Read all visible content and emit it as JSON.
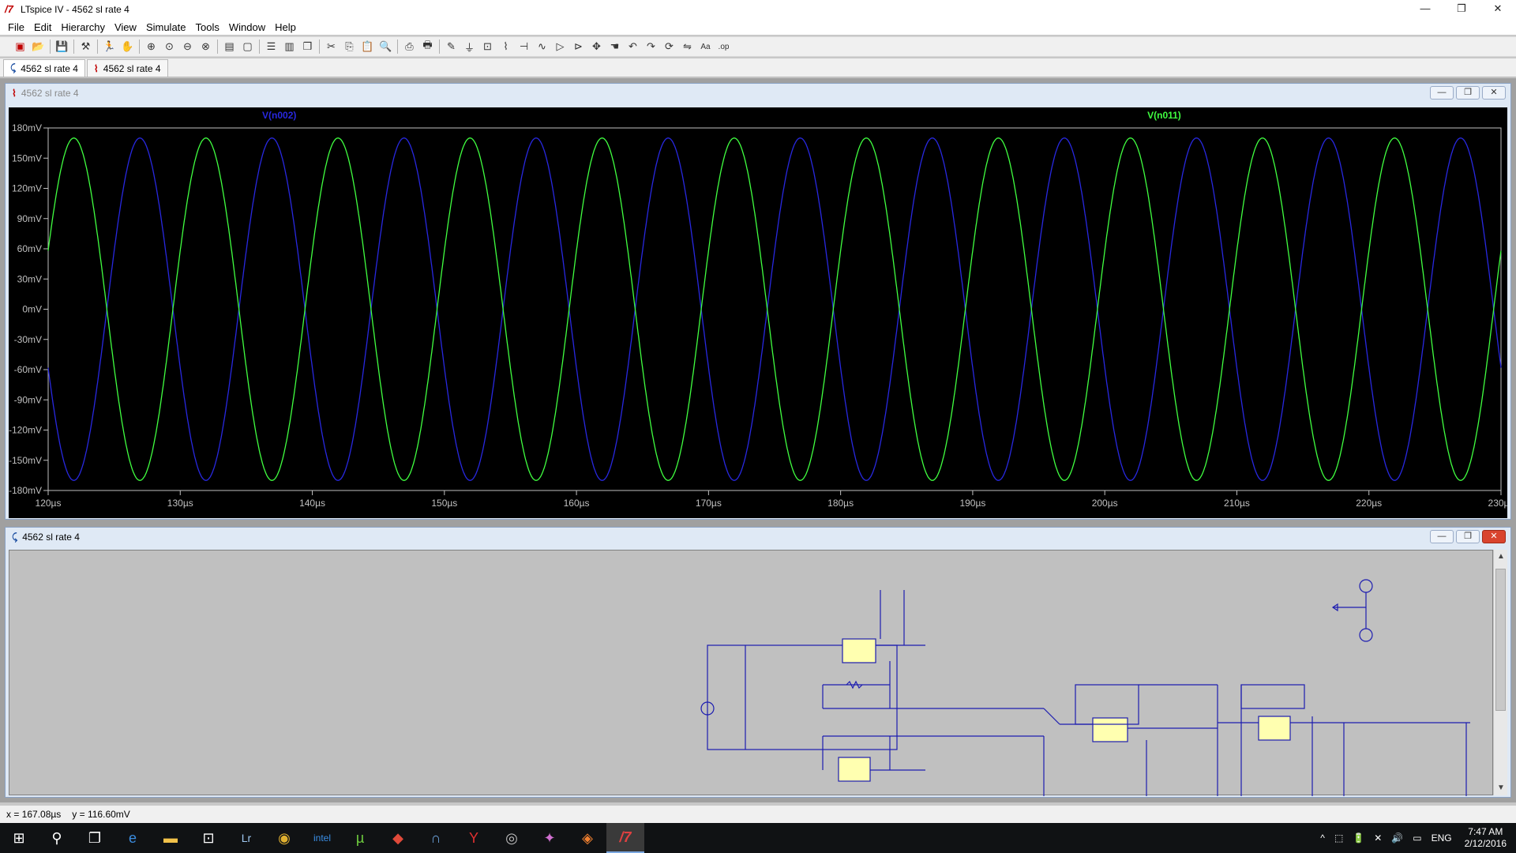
{
  "app": {
    "window_title": "LTspice IV - 4562  sl rate 4",
    "caption_buttons": [
      "—",
      "❐",
      "✕"
    ]
  },
  "menu": [
    "File",
    "Edit",
    "Hierarchy",
    "View",
    "Simulate",
    "Tools",
    "Window",
    "Help"
  ],
  "toolbar_icons": [
    "new-schematic-icon",
    "open-icon",
    "sep",
    "save-icon",
    "sep",
    "control-panel-icon",
    "sep",
    "run-icon",
    "halt-icon",
    "sep",
    "zoom-in-icon",
    "zoom-area-icon",
    "zoom-out-icon",
    "zoom-cancel-icon",
    "sep",
    "autorange-icon",
    "zoom-back-icon",
    "sep",
    "tile-horizontal-icon",
    "tile-vertical-icon",
    "cascade-icon",
    "sep",
    "cut-icon",
    "copy-icon",
    "paste-icon",
    "find-icon",
    "sep",
    "print-setup-icon",
    "print-icon",
    "sep",
    "draw-wire-icon",
    "ground-icon",
    "label-net-icon",
    "resistor-icon",
    "capacitor-icon",
    "inductor-icon",
    "diode-icon",
    "component-icon",
    "move-icon",
    "drag-icon",
    "undo-icon",
    "redo-icon",
    "rotate-icon",
    "mirror-icon",
    "text-icon",
    "spice-directive-icon"
  ],
  "doc_tabs": [
    {
      "icon": "schematic-icon",
      "label": "4562  sl rate 4"
    },
    {
      "icon": "waveform-icon",
      "label": "4562  sl rate 4"
    }
  ],
  "plot_window": {
    "title": "4562  sl rate 4",
    "buttons": [
      "—",
      "❐",
      "✕"
    ]
  },
  "schematic_window": {
    "title": "4562  sl rate 4",
    "buttons": [
      "—",
      "❐",
      "✕"
    ]
  },
  "chart_data": {
    "type": "line",
    "xlabel": "",
    "ylabel": "",
    "xlim": [
      120,
      230
    ],
    "xunit": "µs",
    "ylim": [
      -180,
      180
    ],
    "yunit": "mV",
    "x_ticks": [
      "120µs",
      "130µs",
      "140µs",
      "150µs",
      "160µs",
      "170µs",
      "180µs",
      "190µs",
      "200µs",
      "210µs",
      "220µs",
      "230µs"
    ],
    "y_ticks": [
      "180mV",
      "150mV",
      "120mV",
      "90mV",
      "60mV",
      "30mV",
      "0mV",
      "-30mV",
      "-60mV",
      "-90mV",
      "-120mV",
      "-150mV",
      "-180mV"
    ],
    "series": [
      {
        "name": "V(n002)",
        "color": "#2828e0",
        "amplitude_mV": 170,
        "frequency_kHz": 100,
        "phase_deg": 200
      },
      {
        "name": "V(n011)",
        "color": "#40ff40",
        "amplitude_mV": 170,
        "frequency_kHz": 100,
        "phase_deg": 20
      }
    ],
    "grid": false,
    "legend": "top"
  },
  "statusbar": {
    "x": "x = 167.08µs",
    "y": "y = 116.60mV"
  },
  "taskbar": {
    "icons": [
      "windows-start-icon",
      "search-icon",
      "task-view-icon",
      "edge-icon",
      "file-explorer-icon",
      "store-icon",
      "lightroom-icon",
      "chrome-icon",
      "intel-icon",
      "utorrent-icon",
      "app-red-icon",
      "app-blue-icon",
      "app-y-icon",
      "media-icon",
      "app-color-icon",
      "app-orange-icon",
      "ltspice-icon"
    ],
    "tray": [
      "^",
      "⬚",
      "🔋",
      "✕",
      "🔊",
      "▭",
      "ENG"
    ],
    "time": "7:47 AM",
    "date": "2/12/2016"
  }
}
